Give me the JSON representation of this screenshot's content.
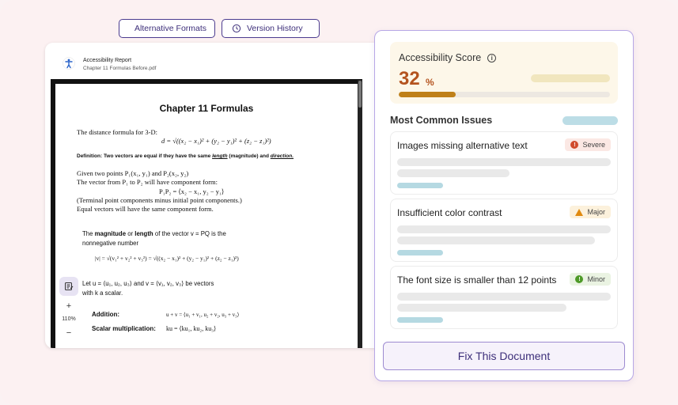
{
  "toolbar": {
    "alt_formats": "Alternative Formats",
    "version_history": "Version History"
  },
  "viewer": {
    "title": "Accessibility Report",
    "filename": "Chapter 11 Formulas Before.pdf",
    "zoom": "110%",
    "zoom_in": "+",
    "zoom_out": "−"
  },
  "doc": {
    "heading": "Chapter 11 Formulas",
    "line1": "The distance formula for 3-D:",
    "formula1": "d = √((x₂ − x₁)² + (y₂ − y₁)² + (z₂ − z₁)²)",
    "def_prefix": "Definition:  Two vectors are equal if they have the same ",
    "def_length": "length",
    "def_mid": " (magnitude) and ",
    "def_direction": "direction.",
    "line2": "Given two points P₁(x₁, y₁) and P₂(x₂, y₂)",
    "line3": "The vector from P₁ to P₂ will have component form:",
    "formula2": "P₁P₂ = ⟨x₂ − x₁, y₂ − y₁⟩",
    "line4": "(Terminal point components minus initial point components.)",
    "line5": "Equal vectors will have the same component form.",
    "line6a": "The ",
    "line6b": "magnitude",
    "line6c": " or ",
    "line6d": "length",
    "line6e": " of the vector v = PQ is the",
    "line7": "nonnegative number",
    "formula3": "|v| = √(v₁² + v₂² + v₃²) = √((x₂ − x₁)² + (y₂ − y₁)² + (z₂ − z₁)²)",
    "line8": "Let  u = ⟨u₁, u₂, u₃⟩ and v = ⟨v₁, v₂, v₃⟩ be vectors",
    "line9": "with k a scalar.",
    "addition_label": "Addition:",
    "addition_formula": "u + v = ⟨u₁ + v₁, u₂ + v₂, u₃ + v₃⟩",
    "scalar_label": "Scalar multiplication:",
    "scalar_formula": "ku = ⟨ku₁, ku₂, ku₃⟩"
  },
  "score": {
    "label": "Accessibility Score",
    "value": "32",
    "unit": "%",
    "progress": 0.27
  },
  "issues": {
    "title": "Most Common Issues",
    "items": [
      {
        "title": "Images missing alternative text",
        "severity": "Severe"
      },
      {
        "title": "Insufficient color contrast",
        "severity": "Major"
      },
      {
        "title": "The font size is smaller than 12 points",
        "severity": "Minor"
      }
    ]
  },
  "fix_button": "Fix This Document",
  "colors": {
    "accent": "#3d2f7a",
    "score": "#b4531f",
    "severe": "#d04a2c",
    "major": "#e08a10",
    "minor": "#4e9a28"
  }
}
